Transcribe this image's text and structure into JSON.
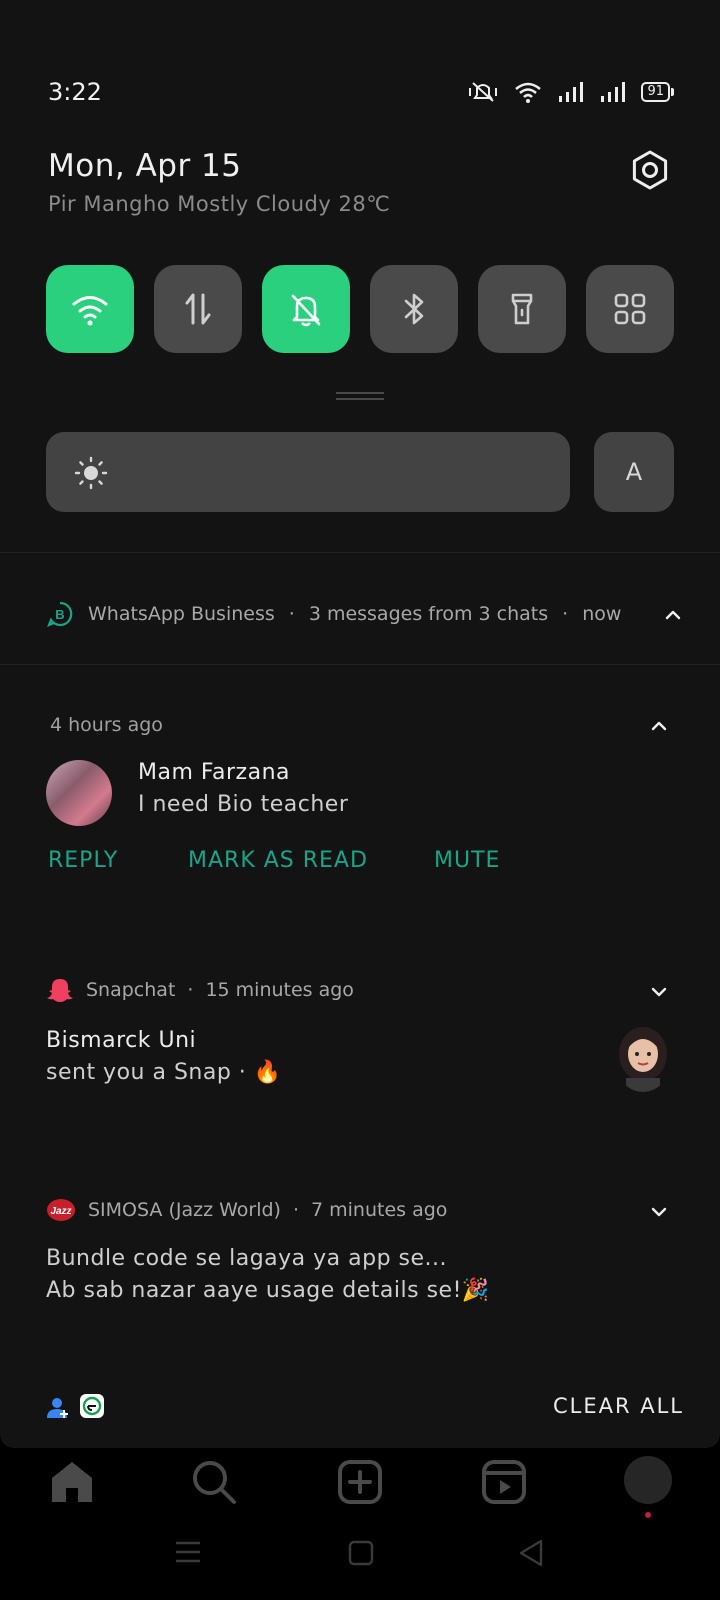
{
  "status_bar": {
    "time": "3:22",
    "battery": "91"
  },
  "header": {
    "date": "Mon, Apr 15",
    "weather": "Pir Mangho Mostly Cloudy 28℃"
  },
  "quick_tiles": [
    {
      "name": "wifi",
      "active": true
    },
    {
      "name": "mobile-data",
      "active": false
    },
    {
      "name": "silent",
      "active": true
    },
    {
      "name": "bluetooth",
      "active": false
    },
    {
      "name": "flashlight",
      "active": false
    },
    {
      "name": "more-tiles",
      "active": false
    }
  ],
  "brightness": {
    "auto_label": "A"
  },
  "whatsapp": {
    "app": "WhatsApp Business",
    "summary": "3 messages from 3 chats",
    "when": "now",
    "group_time": "4 hours ago",
    "sender": "Mam Farzana",
    "message": "I need Bio teacher",
    "actions": [
      "REPLY",
      "MARK AS READ",
      "MUTE"
    ]
  },
  "snapchat": {
    "app": "Snapchat",
    "when": "15 minutes ago",
    "title": "Bismarck Uni",
    "body": "sent you a Snap · 🔥"
  },
  "simosa": {
    "app": "SIMOSA (Jazz World)",
    "when": "7 minutes ago",
    "line1": "Bundle code se lagaya ya app se...",
    "line2": "Ab sab nazar aaye usage details se!🎉"
  },
  "footer": {
    "clear_all": "CLEAR ALL"
  },
  "colors": {
    "accent": "#2bd07f",
    "action": "#1aa588",
    "shade": "#131313",
    "tile": "#4a4a4a"
  }
}
